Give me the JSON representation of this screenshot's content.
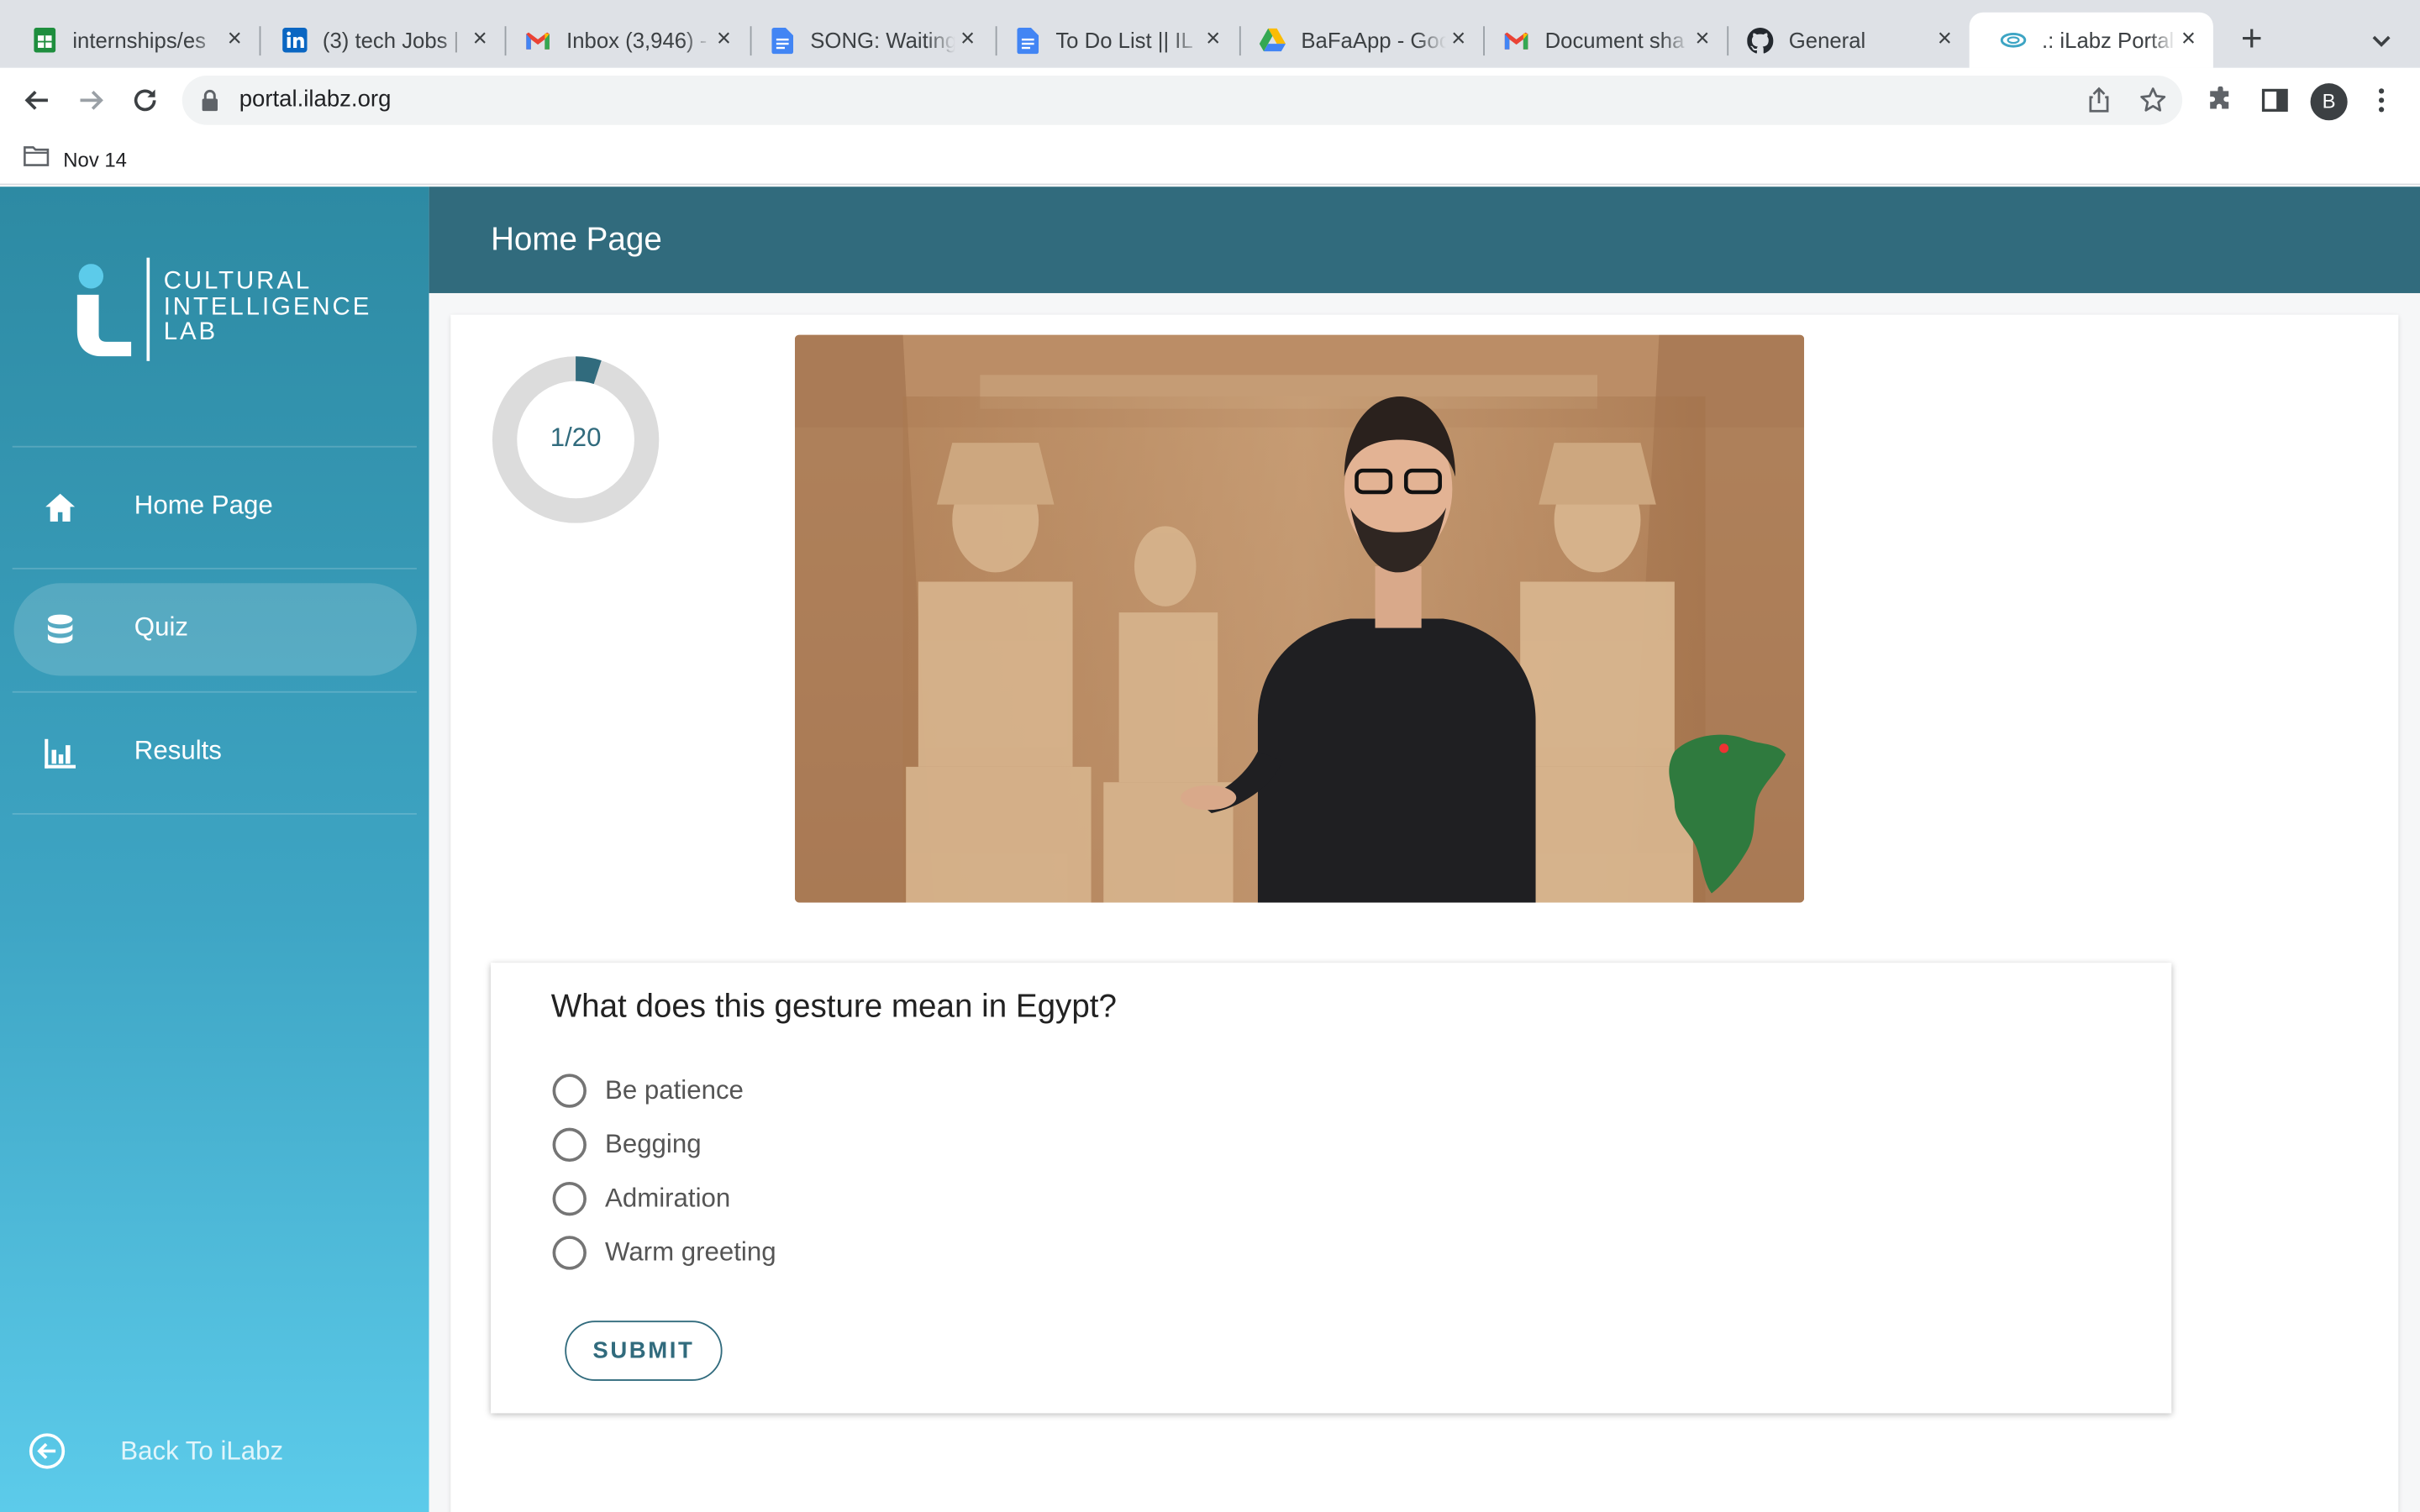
{
  "browser": {
    "tabs": [
      {
        "title": "internships/es",
        "icon": "google-sheets-icon"
      },
      {
        "title": "(3) tech Jobs |",
        "icon": "linkedin-icon"
      },
      {
        "title": "Inbox (3,946) -",
        "icon": "gmail-icon"
      },
      {
        "title": "SONG: Waiting",
        "icon": "google-docs-icon"
      },
      {
        "title": "To Do List || IL",
        "icon": "google-docs-icon"
      },
      {
        "title": "BaFaApp - Goo",
        "icon": "google-drive-icon"
      },
      {
        "title": "Document sha",
        "icon": "gmail-icon"
      },
      {
        "title": "General",
        "icon": "github-icon"
      },
      {
        "title": ".: iLabz Portal",
        "icon": "ilabz-icon",
        "active": true
      }
    ],
    "url": "portal.ilabz.org",
    "profile_initial": "B",
    "bookmark": "Nov 14"
  },
  "sidebar": {
    "logo": {
      "line1": "CULTURAL",
      "line2": "INTELLIGENCE",
      "line3": "LAB"
    },
    "items": [
      {
        "label": "Home Page",
        "icon": "home-icon"
      },
      {
        "label": "Quiz",
        "icon": "database-icon",
        "active": true
      },
      {
        "label": "Results",
        "icon": "bar-chart-icon"
      }
    ],
    "back_label": "Back To iLabz"
  },
  "header": {
    "title": "Home Page"
  },
  "quiz": {
    "progress_text": "1/20",
    "progress_fraction": 0.05,
    "question": "What does this gesture mean in Egypt?",
    "options": [
      "Be patience",
      "Begging",
      "Admiration",
      "Warm greeting"
    ],
    "submit_label": "SUBMIT"
  },
  "colors": {
    "accent": "#316b7d",
    "sidebar_top": "#2d8aa3",
    "sidebar_bottom": "#5ccbea",
    "progress_track": "#dcdcdc"
  }
}
